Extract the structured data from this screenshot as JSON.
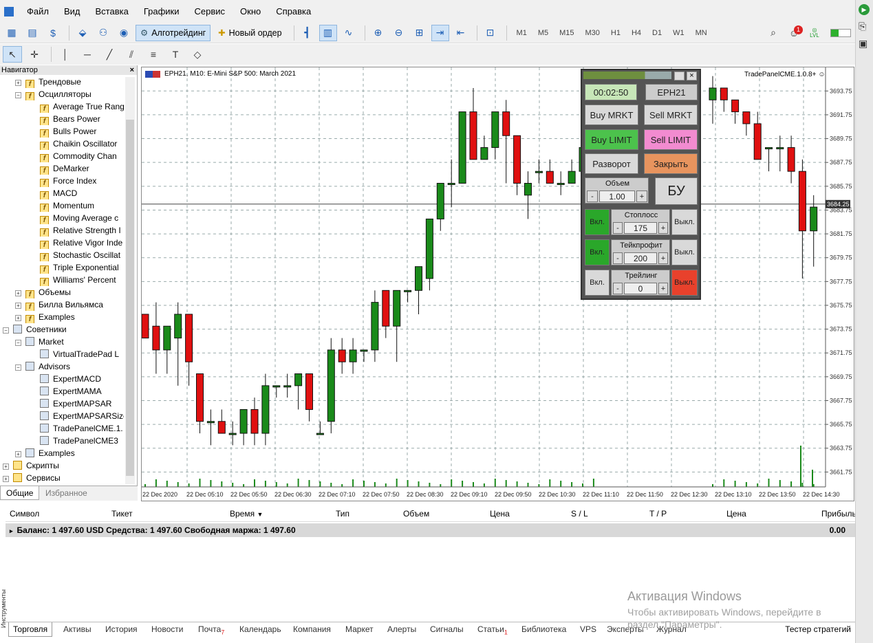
{
  "menu": [
    "Файл",
    "Вид",
    "Вставка",
    "Графики",
    "Сервис",
    "Окно",
    "Справка"
  ],
  "toolbar": {
    "algo": "Алготрейдинг",
    "new_order": "Новый ордер",
    "timeframes": [
      "M1",
      "M5",
      "M15",
      "M30",
      "H1",
      "H4",
      "D1",
      "W1",
      "MN"
    ]
  },
  "navigator": {
    "title": "Навигатор",
    "items": [
      {
        "label": "Трендовые",
        "kind": "folder"
      },
      {
        "label": "Осцилляторы",
        "kind": "folder"
      },
      {
        "label": "Average True Rang",
        "kind": "ind"
      },
      {
        "label": "Bears Power",
        "kind": "ind"
      },
      {
        "label": "Bulls Power",
        "kind": "ind"
      },
      {
        "label": "Chaikin Oscillator",
        "kind": "ind"
      },
      {
        "label": "Commodity Chan",
        "kind": "ind"
      },
      {
        "label": "DeMarker",
        "kind": "ind"
      },
      {
        "label": "Force Index",
        "kind": "ind"
      },
      {
        "label": "MACD",
        "kind": "ind"
      },
      {
        "label": "Momentum",
        "kind": "ind"
      },
      {
        "label": "Moving Average c",
        "kind": "ind"
      },
      {
        "label": "Relative Strength I",
        "kind": "ind"
      },
      {
        "label": "Relative Vigor Inde",
        "kind": "ind"
      },
      {
        "label": "Stochastic Oscillat",
        "kind": "ind"
      },
      {
        "label": "Triple Exponential",
        "kind": "ind"
      },
      {
        "label": "Williams' Percent",
        "kind": "ind"
      },
      {
        "label": "Объемы",
        "kind": "folder"
      },
      {
        "label": "Билла Вильямса",
        "kind": "folder"
      },
      {
        "label": "Examples",
        "kind": "folder"
      },
      {
        "label": "Советники",
        "kind": "root"
      },
      {
        "label": "Market",
        "kind": "eafolder"
      },
      {
        "label": "VirtualTradePad  L",
        "kind": "ea"
      },
      {
        "label": "Advisors",
        "kind": "eafolder"
      },
      {
        "label": "ExpertMACD",
        "kind": "ea"
      },
      {
        "label": "ExpertMAMA",
        "kind": "ea"
      },
      {
        "label": "ExpertMAPSAR",
        "kind": "ea"
      },
      {
        "label": "ExpertMAPSARSize",
        "kind": "ea"
      },
      {
        "label": "TradePanelCME.1.",
        "kind": "ea"
      },
      {
        "label": "TradePanelCME3",
        "kind": "ea"
      },
      {
        "label": "Examples",
        "kind": "eafolder"
      },
      {
        "label": "Скрипты",
        "kind": "root"
      },
      {
        "label": "Сервисы",
        "kind": "root"
      }
    ],
    "tabs": [
      "Общие",
      "Избранное"
    ]
  },
  "chart_header": {
    "symbol": "EPH21, M10:  E-Mini S&P 500: March 2021",
    "expert": "TradePanelCME.1.0.8+"
  },
  "chart_data": {
    "type": "candlestick",
    "title": "EPH21, M10:  E-Mini S&P 500: March 2021",
    "ylim": [
      3660.5,
      3695.5
    ],
    "y_ticks": [
      3693.75,
      3691.75,
      3689.75,
      3687.75,
      3685.75,
      3683.75,
      3681.75,
      3679.75,
      3677.75,
      3675.75,
      3673.75,
      3671.75,
      3669.75,
      3667.75,
      3665.75,
      3663.75,
      3661.75
    ],
    "x_ticks": [
      "22 Dec 2020",
      "22 Dec 05:10",
      "22 Dec 05:50",
      "22 Dec 06:30",
      "22 Dec 07:10",
      "22 Dec 07:50",
      "22 Dec 08:30",
      "22 Dec 09:10",
      "22 Dec 09:50",
      "22 Dec 10:30",
      "22 Dec 11:10",
      "22 Dec 11:50",
      "22 Dec 12:30",
      "22 Dec 13:10",
      "22 Dec 13:50",
      "22 Dec 14:30"
    ],
    "current_price": "3684.25",
    "candles": [
      [
        3675,
        3675,
        3673,
        3673
      ],
      [
        3674,
        3676,
        3670,
        3672
      ],
      [
        3672,
        3674,
        3670,
        3674
      ],
      [
        3673,
        3676,
        3669,
        3675
      ],
      [
        3675,
        3675,
        3669,
        3671
      ],
      [
        3670,
        3670,
        3665,
        3666
      ],
      [
        3666,
        3667,
        3664,
        3666
      ],
      [
        3666,
        3667,
        3665,
        3665
      ],
      [
        3665,
        3666,
        3664,
        3665
      ],
      [
        3665,
        3667,
        3664,
        3667
      ],
      [
        3667,
        3668,
        3664,
        3665
      ],
      [
        3665,
        3670,
        3664,
        3669
      ],
      [
        3669,
        3669,
        3668,
        3669
      ],
      [
        3669,
        3670,
        3668,
        3669
      ],
      [
        3669,
        3670,
        3667,
        3670
      ],
      [
        3670,
        3670,
        3666,
        3667
      ],
      [
        3665,
        3666,
        3665,
        3665
      ],
      [
        3666,
        3673,
        3665,
        3672
      ],
      [
        3672,
        3673,
        3670,
        3671
      ],
      [
        3671,
        3673,
        3670,
        3672
      ],
      [
        3672,
        3672,
        3671,
        3672
      ],
      [
        3672,
        3677,
        3671,
        3676
      ],
      [
        3677,
        3677,
        3673,
        3674
      ],
      [
        3674,
        3677,
        3671,
        3677
      ],
      [
        3677,
        3677,
        3676,
        3677
      ],
      [
        3677,
        3678,
        3675,
        3679
      ],
      [
        3678,
        3683,
        3677,
        3683
      ],
      [
        3683,
        3685,
        3682,
        3686
      ],
      [
        3686,
        3688,
        3684,
        3686
      ],
      [
        3686,
        3692,
        3686,
        3692
      ],
      [
        3692,
        3694,
        3688,
        3688
      ],
      [
        3688,
        3690,
        3688,
        3689
      ],
      [
        3689,
        3692,
        3688,
        3692
      ],
      [
        3692,
        3693,
        3686,
        3690
      ],
      [
        3690,
        3690,
        3685,
        3686
      ],
      [
        3685,
        3687,
        3683,
        3686
      ],
      [
        3687,
        3688,
        3686,
        3687
      ],
      [
        3687,
        3688,
        3686,
        3686
      ],
      [
        3686,
        3687,
        3685,
        3686
      ],
      [
        3686,
        3688,
        3686,
        3687
      ],
      [
        3687,
        3690,
        3685,
        3689
      ],
      [
        3689,
        3690,
        3686,
        3688
      ]
    ],
    "candles_right": [
      [
        3693,
        3695,
        3691,
        3694
      ],
      [
        3694,
        3694,
        3692,
        3693
      ],
      [
        3693,
        3693,
        3691,
        3692
      ],
      [
        3692,
        3692,
        3690,
        3691
      ],
      [
        3691,
        3692,
        3688,
        3688
      ],
      [
        3689,
        3689,
        3687,
        3689
      ],
      [
        3689,
        3690,
        3687,
        3689
      ],
      [
        3689,
        3690,
        3686,
        3687
      ],
      [
        3687,
        3688,
        3678,
        3682
      ],
      [
        3682,
        3685,
        3679,
        3684
      ]
    ]
  },
  "panel": {
    "timer": "00:02:50",
    "symbol": "EPH21",
    "buy_mrkt": "Buy MRKT",
    "sell_mrkt": "Sell MRKT",
    "buy_limit": "Buy LIMIT",
    "sell_limit": "Sell LIMIT",
    "reverse": "Разворот",
    "close": "Закрыть",
    "volume_label": "Объем",
    "volume": "1.00",
    "minus": "-",
    "plus": "+",
    "bu": "БУ",
    "on": "Вкл.",
    "off": "Выкл.",
    "stoploss_label": "Стоплосс",
    "stoploss": "175",
    "takeprofit_label": "Тейкпрофит",
    "takeprofit": "200",
    "trailing_label": "Трейлинг",
    "trailing": "0"
  },
  "terminal": {
    "columns": [
      "Символ",
      "Тикет",
      "Время",
      "Тип",
      "Объем",
      "Цена",
      "S / L",
      "T / P",
      "Цена",
      "Прибыль"
    ],
    "balance": "Баланс: 1 497.60 USD  Средства: 1 497.60  Свободная маржа: 1 497.60",
    "profit": "0.00",
    "tabs": [
      "Торговля",
      "Активы",
      "История",
      "Новости",
      "Почта",
      "Календарь",
      "Компания",
      "Маркет",
      "Алерты",
      "Сигналы",
      "Статьи",
      "Библиотека",
      "VPS",
      "Эксперты",
      "Журнал"
    ],
    "mail_count": "7",
    "articles_count": "1",
    "tester": "Тестер стратегий",
    "side_label": "Инструменты"
  },
  "watermark": {
    "title": "Активация Windows",
    "text": "Чтобы активировать Windows, перейдите в раздел \"Параметры\"."
  },
  "notifications": "1",
  "lvl": "LVL"
}
